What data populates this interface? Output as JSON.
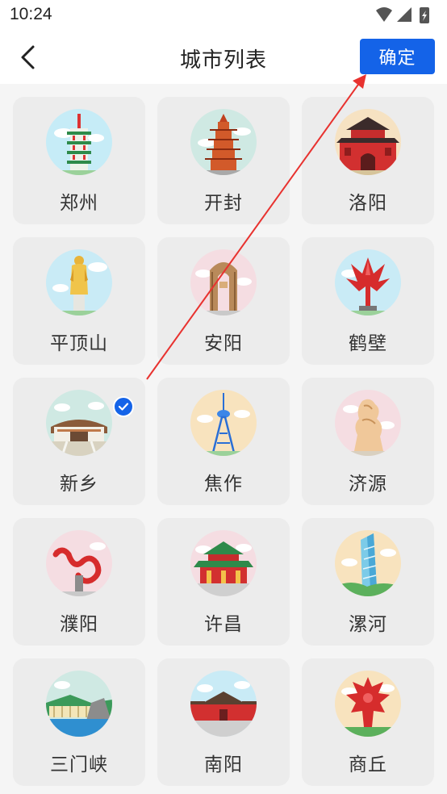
{
  "status": {
    "time": "10:24"
  },
  "header": {
    "title": "城市列表",
    "confirm_label": "确定"
  },
  "accent_color": "#1463e8",
  "cities": [
    {
      "name": "郑州",
      "icon": "twin-tower-pagoda-icon",
      "selected": false
    },
    {
      "name": "开封",
      "icon": "iron-pagoda-icon",
      "selected": false
    },
    {
      "name": "洛阳",
      "icon": "red-city-gate-icon",
      "selected": false
    },
    {
      "name": "平顶山",
      "icon": "golden-buddha-statue-icon",
      "selected": false
    },
    {
      "name": "安阳",
      "icon": "stone-arch-monument-icon",
      "selected": false
    },
    {
      "name": "鹤壁",
      "icon": "red-crane-sculpture-icon",
      "selected": false
    },
    {
      "name": "新乡",
      "icon": "stadium-plaza-icon",
      "selected": true
    },
    {
      "name": "焦作",
      "icon": "tv-tower-icon",
      "selected": false
    },
    {
      "name": "济源",
      "icon": "dragon-sculpture-icon",
      "selected": false
    },
    {
      "name": "濮阳",
      "icon": "red-dragon-sculpture-icon",
      "selected": false
    },
    {
      "name": "许昌",
      "icon": "pavilion-icon",
      "selected": false
    },
    {
      "name": "漯河",
      "icon": "skyscraper-icon",
      "selected": false
    },
    {
      "name": "三门峡",
      "icon": "dam-landscape-icon",
      "selected": false
    },
    {
      "name": "南阳",
      "icon": "ancient-hall-icon",
      "selected": false
    },
    {
      "name": "商丘",
      "icon": "red-totem-sculpture-icon",
      "selected": false
    }
  ]
}
